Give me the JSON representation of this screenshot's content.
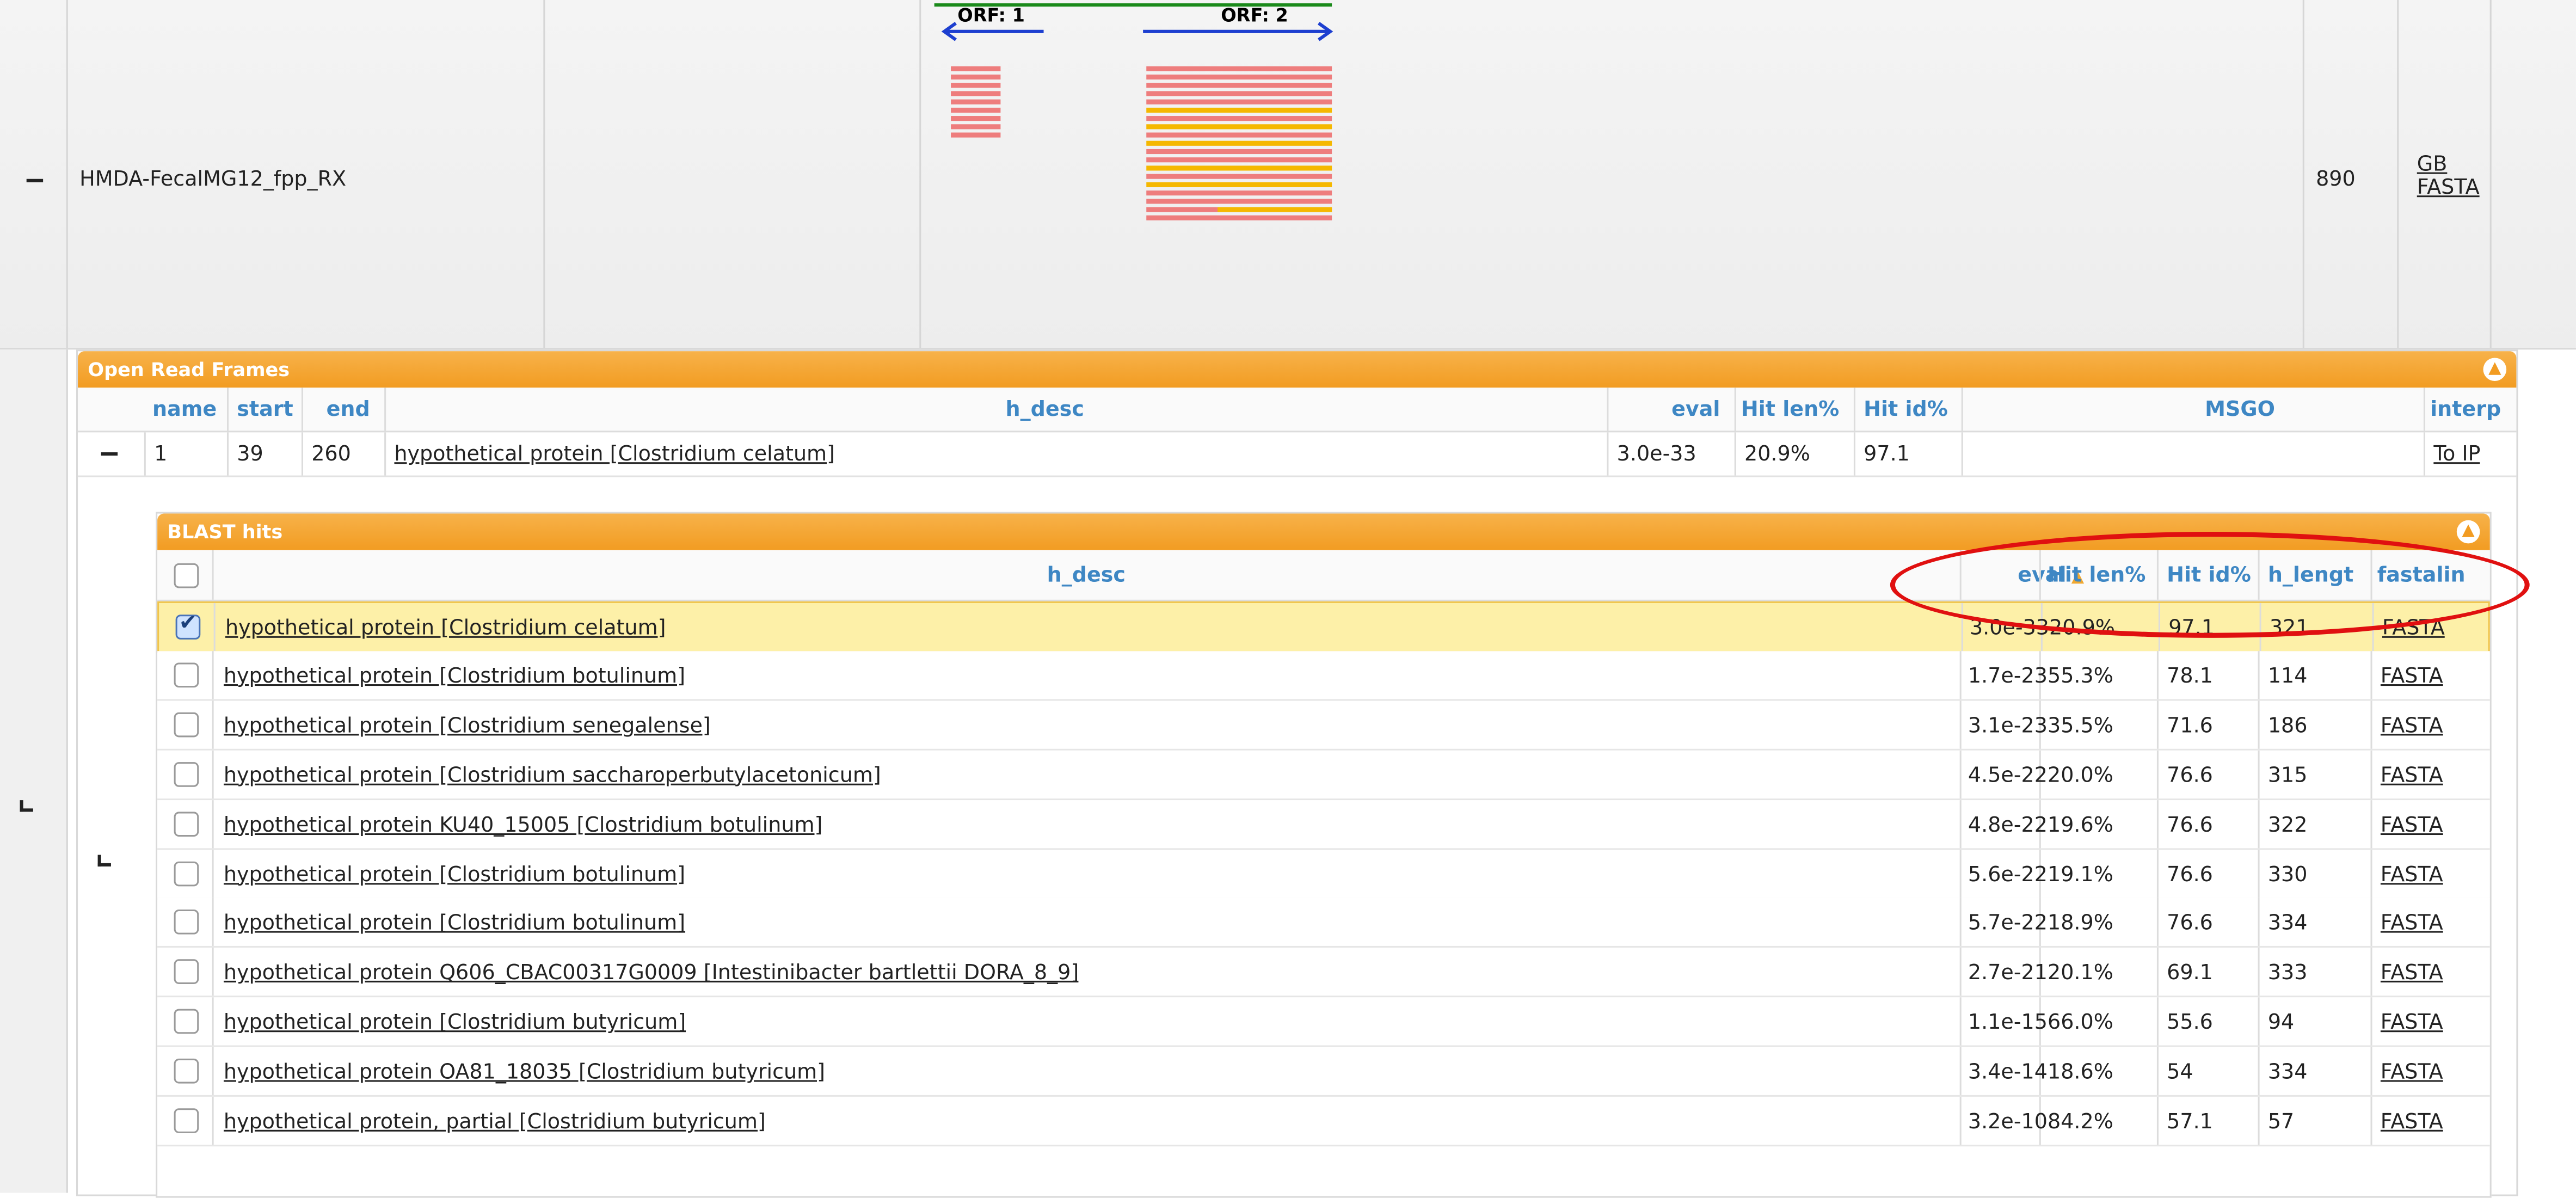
{
  "contig": {
    "name": "HMDA-FecalMG12_fpp_RX",
    "length": "890",
    "links": [
      "GB",
      "FASTA"
    ],
    "orf_labels": [
      "ORF: 1",
      "ORF: 2"
    ]
  },
  "colors": {
    "accent": "#f29c22",
    "header_text": "#3e87c4",
    "selected_row": "#fdf0a8",
    "annotation": "#e01010"
  },
  "orf_panel": {
    "title": "Open Read Frames",
    "columns": [
      "name",
      "start",
      "end",
      "h_desc",
      "eval",
      "Hit len%",
      "Hit id%",
      "MSGO",
      "interp"
    ],
    "row": {
      "name": "1",
      "start": "39",
      "end": "260",
      "h_desc": "hypothetical protein [Clostridium celatum]",
      "eval": "3.0e-33",
      "hit_len": "20.9%",
      "hit_id": "97.1",
      "msgo": "",
      "interp": "To IP"
    }
  },
  "blast_panel": {
    "title": "BLAST hits",
    "columns": {
      "h_desc": "h_desc",
      "eval": "eval",
      "hit_len": "Hit len%",
      "hit_id": "Hit id%",
      "h_length": "h_lengt",
      "fastalink": "fastalin"
    },
    "rows": [
      {
        "checked": true,
        "h_desc": "hypothetical protein [Clostridium celatum]",
        "eval": "3.0e-33",
        "hit_len": "20.9%",
        "hit_id": "97.1",
        "h_length": "321",
        "fasta": "FASTA"
      },
      {
        "checked": false,
        "h_desc": "hypothetical protein [Clostridium botulinum]",
        "eval": "1.7e-23",
        "hit_len": "55.3%",
        "hit_id": "78.1",
        "h_length": "114",
        "fasta": "FASTA"
      },
      {
        "checked": false,
        "h_desc": "hypothetical protein [Clostridium senegalense]",
        "eval": "3.1e-23",
        "hit_len": "35.5%",
        "hit_id": "71.6",
        "h_length": "186",
        "fasta": "FASTA"
      },
      {
        "checked": false,
        "h_desc": "hypothetical protein [Clostridium saccharoperbutylacetonicum]",
        "eval": "4.5e-22",
        "hit_len": "20.0%",
        "hit_id": "76.6",
        "h_length": "315",
        "fasta": "FASTA"
      },
      {
        "checked": false,
        "h_desc": "hypothetical protein KU40_15005 [Clostridium botulinum]",
        "eval": "4.8e-22",
        "hit_len": "19.6%",
        "hit_id": "76.6",
        "h_length": "322",
        "fasta": "FASTA"
      },
      {
        "checked": false,
        "h_desc": "hypothetical protein [Clostridium botulinum]",
        "eval": "5.6e-22",
        "hit_len": "19.1%",
        "hit_id": "76.6",
        "h_length": "330",
        "fasta": "FASTA"
      },
      {
        "checked": false,
        "h_desc": "hypothetical protein [Clostridium botulinum]",
        "eval": "5.7e-22",
        "hit_len": "18.9%",
        "hit_id": "76.6",
        "h_length": "334",
        "fasta": "FASTA"
      },
      {
        "checked": false,
        "h_desc": "hypothetical protein Q606_CBAC00317G0009 [Intestinibacter bartlettii DORA_8_9]",
        "eval": "2.7e-21",
        "hit_len": "20.1%",
        "hit_id": "69.1",
        "h_length": "333",
        "fasta": "FASTA"
      },
      {
        "checked": false,
        "h_desc": "hypothetical protein [Clostridium butyricum]",
        "eval": "1.1e-15",
        "hit_len": "66.0%",
        "hit_id": "55.6",
        "h_length": "94",
        "fasta": "FASTA"
      },
      {
        "checked": false,
        "h_desc": "hypothetical protein OA81_18035 [Clostridium butyricum]",
        "eval": "3.4e-14",
        "hit_len": "18.6%",
        "hit_id": "54",
        "h_length": "334",
        "fasta": "FASTA"
      },
      {
        "checked": false,
        "h_desc": "hypothetical protein, partial [Clostridium butyricum]",
        "eval": "3.2e-10",
        "hit_len": "84.2%",
        "hit_id": "57.1",
        "h_length": "57",
        "fasta": "FASTA"
      }
    ]
  }
}
